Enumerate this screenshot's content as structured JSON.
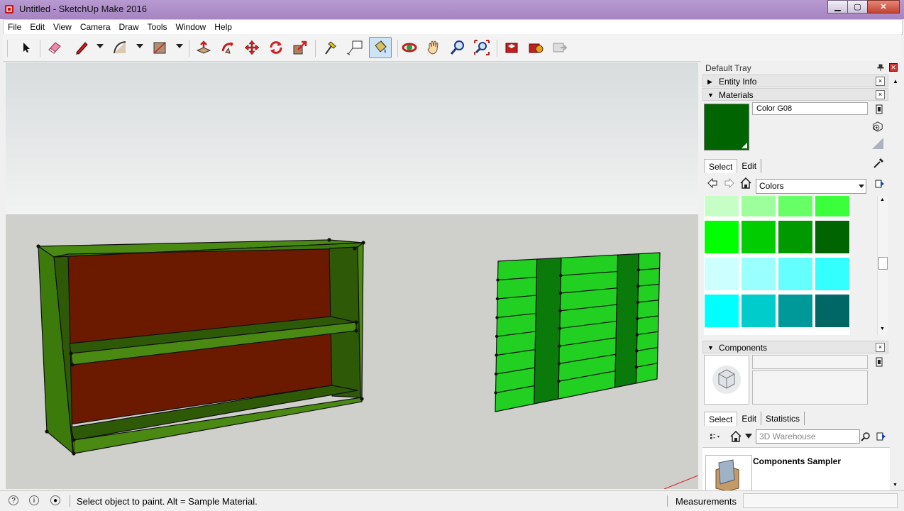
{
  "window": {
    "title": "Untitled - SketchUp Make 2016",
    "minimize": "▁",
    "maximize": "▢",
    "close": "✕"
  },
  "menu": [
    "File",
    "Edit",
    "View",
    "Camera",
    "Draw",
    "Tools",
    "Window",
    "Help"
  ],
  "toolbar": {
    "tools": [
      "select-tool",
      "eraser-tool",
      "line-tool",
      "arc-tool",
      "rectangle-tool",
      "push-pull-tool",
      "follow-me-tool",
      "move-tool",
      "rotate-tool",
      "scale-tool",
      "tape-measure-tool",
      "text-tool",
      "paint-bucket-tool",
      "orbit-tool",
      "pan-tool",
      "zoom-tool",
      "zoom-extents-tool",
      "warehouse-tool",
      "extension-warehouse-tool",
      "share-model-tool"
    ],
    "active": "paint-bucket-tool",
    "text_tool_label": "A1"
  },
  "tray": {
    "title": "Default Tray",
    "entity_info": "Entity Info",
    "materials": {
      "header": "Materials",
      "current_name": "Color G08",
      "current_color": "#006400",
      "tabs": [
        "Select",
        "Edit"
      ],
      "library": "Colors",
      "swatches": [
        [
          "#c6ffc6",
          "#9cff9c",
          "#66ff66",
          "#3cff3c"
        ],
        [
          "#00ff00",
          "#00cc00",
          "#009900",
          "#006400"
        ],
        [
          "#ccffff",
          "#99ffff",
          "#66ffff",
          "#33ffff"
        ],
        [
          "#00ffff",
          "#00cccc",
          "#009999",
          "#006666"
        ]
      ]
    },
    "components": {
      "header": "Components",
      "tabs": [
        "Select",
        "Edit",
        "Statistics"
      ],
      "search_placeholder": "3D Warehouse",
      "sampler_title": "Components Sampler"
    }
  },
  "status": {
    "message": "Select object to paint. Alt = Sample Material.",
    "measurements_label": "Measurements",
    "measurements_value": ""
  },
  "scene": {
    "sky_color": "#e6e8e8",
    "ground_color": "#cfcfcc",
    "shelf_frame_color": "#3d7a0c",
    "shelf_back_color": "#6b1a00",
    "panel_light": "#22d022",
    "panel_dark": "#0a7a0a"
  }
}
